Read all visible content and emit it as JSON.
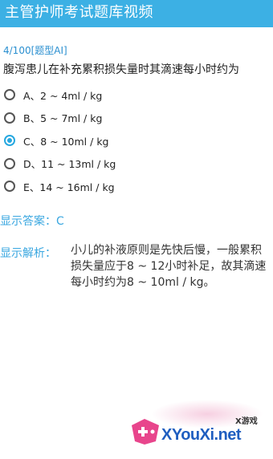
{
  "header": {
    "title": "主管护师考试题库视频"
  },
  "question": {
    "number": "4/100[题型AI]",
    "text": "腹泻患儿在补充累积损失量时其滴速每小时约为"
  },
  "options": [
    {
      "label": "A、2 ~ 4ml / kg",
      "selected": false
    },
    {
      "label": "B、5 ~ 7ml / kg",
      "selected": false
    },
    {
      "label": "C、8 ~ 10ml / kg",
      "selected": true
    },
    {
      "label": "D、11 ~ 13ml / kg",
      "selected": false
    },
    {
      "label": "E、14 ~ 16ml / kg",
      "selected": false
    }
  ],
  "answer": {
    "text": "显示答案：C"
  },
  "analysis": {
    "label": "显示解析：",
    "text": "小儿的补液原则是先快后慢，一般累积损失量应于8 ~ 12小时补足，故其滴速每小时约为8 ~ 10ml / kg。"
  },
  "watermark": {
    "small": "X游戏",
    "text": "XYouXi.net"
  },
  "colors": {
    "accent": "#3cb0e4",
    "selected": "#27a8e0"
  }
}
